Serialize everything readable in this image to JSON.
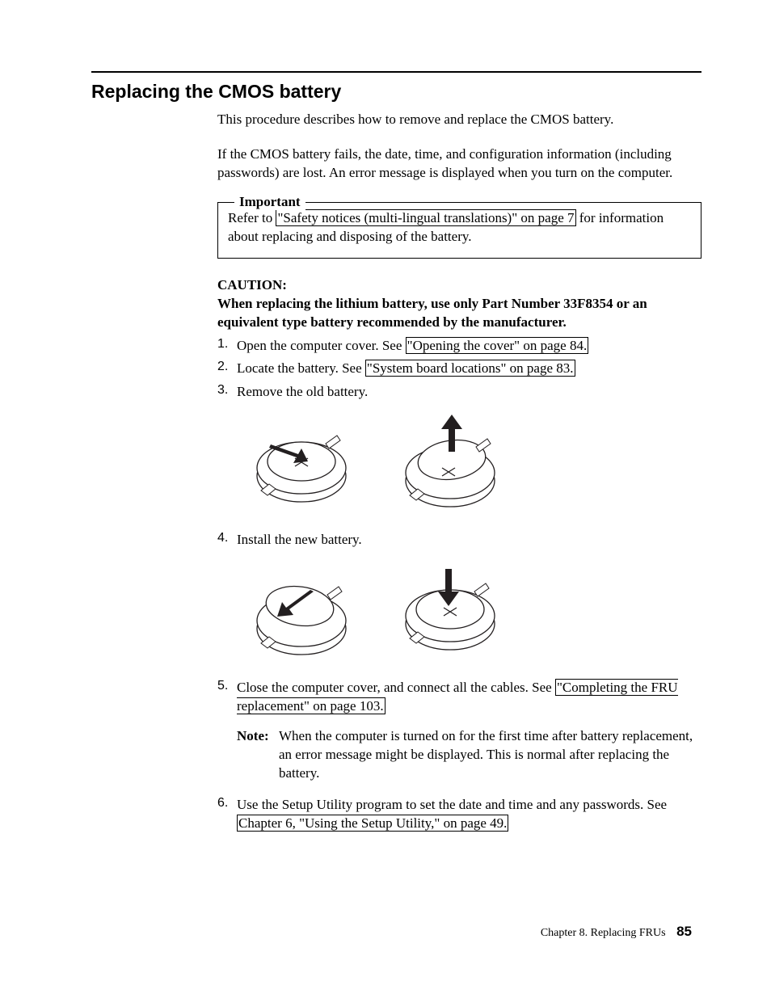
{
  "heading": "Replacing the CMOS battery",
  "intro_p1": "This procedure describes how to remove and replace the CMOS battery.",
  "intro_p2": "If the CMOS battery fails, the date, time, and configuration information (including passwords) are lost. An error message is displayed when you turn on the computer.",
  "important": {
    "legend": "Important",
    "prefix": "Refer to",
    "link": "\"Safety notices (multi-lingual translations)\" on page 7",
    "suffix": " for information about replacing and disposing of the battery."
  },
  "caution_label": "CAUTION:",
  "caution_text": "When replacing the lithium battery, use only Part Number 33F8354 or an equivalent type battery recommended by the manufacturer.",
  "steps": {
    "s1": {
      "n": "1.",
      "pre": "Open the computer cover. See ",
      "link": "\"Opening the cover\" on page 84."
    },
    "s2": {
      "n": "2.",
      "pre": "Locate the battery. See ",
      "link": "\"System board locations\" on page 83."
    },
    "s3": {
      "n": "3.",
      "text": "Remove the old battery."
    },
    "s4": {
      "n": "4.",
      "text": "Install the new battery."
    },
    "s5": {
      "n": "5.",
      "pre": "Close the computer cover, and connect all the cables. See ",
      "link": "\"Completing the FRU replacement\" on page 103."
    },
    "s6": {
      "n": "6.",
      "pre": "Use the Setup Utility program to set the date and time and any passwords. See ",
      "link": "Chapter 6, \"Using the Setup Utility,\" on page 49."
    }
  },
  "note": {
    "label": "Note:",
    "text": "When the computer is turned on for the first time after battery replacement, an error message might be displayed. This is normal after replacing the battery."
  },
  "footer": {
    "chapter": "Chapter 8. Replacing FRUs",
    "page": "85"
  }
}
